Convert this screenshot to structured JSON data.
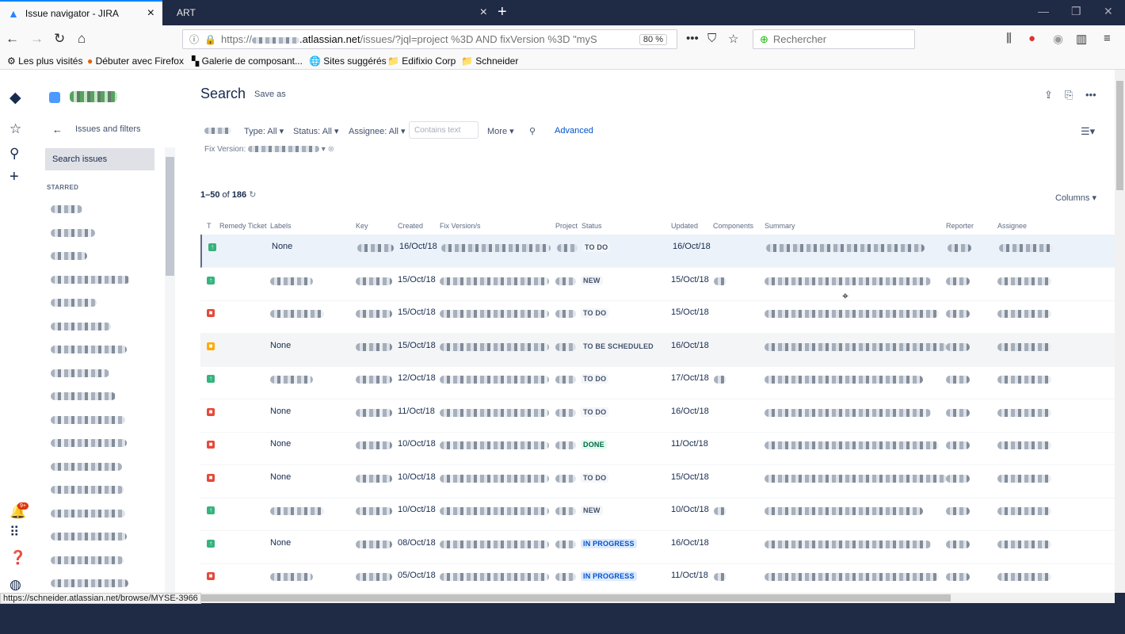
{
  "browser": {
    "tabs": [
      {
        "title": "Issue navigator - JIRA",
        "active": true
      },
      {
        "title": "ART",
        "active": false
      }
    ],
    "url_display": "https://",
    "url_domain": ".atlassian.net",
    "url_rest": "/issues/?jql=project %3D  AND fixVersion %3D \"myS",
    "zoom": "80 %",
    "search_placeholder": "Rechercher",
    "bookmarks": [
      "Les plus visités",
      "Débuter avec Firefox",
      "Galerie de composant...",
      "Sites suggérés",
      "Edifixio Corp",
      "Schneider"
    ],
    "status_url": "https://schneider.atlassian.net/browse/MYSE-3966",
    "accent": "#0a84ff"
  },
  "sidebar": {
    "back_label": "Issues and filters",
    "search_label": "Search issues",
    "starred_label": "STARRED",
    "notification_count": "9+",
    "starred_count": 17
  },
  "main": {
    "title": "Search",
    "save_as": "Save as",
    "filters": {
      "type": "Type: All",
      "status": "Status: All",
      "assignee": "Assignee: All",
      "contains_placeholder": "Contains text",
      "more": "More",
      "advanced": "Advanced",
      "fix_version": "Fix Version:"
    },
    "count_range": "1–50",
    "count_of": "of",
    "count_total": "186",
    "columns_btn": "Columns",
    "headers": [
      "T",
      "Remedy Ticket",
      "Labels",
      "Key",
      "Created",
      "Fix Version/s",
      "Project",
      "Status",
      "Updated",
      "Components",
      "Summary",
      "Reporter",
      "Assignee"
    ],
    "rows": [
      {
        "type": "story",
        "labels": "None",
        "created": "16/Oct/18",
        "status": "TO DO",
        "status_color": "grey",
        "updated": "16/Oct/18"
      },
      {
        "type": "story",
        "labels": "",
        "created": "15/Oct/18",
        "status": "NEW",
        "status_color": "grey",
        "updated": "15/Oct/18"
      },
      {
        "type": "bug",
        "labels": "",
        "created": "15/Oct/18",
        "status": "TO DO",
        "status_color": "grey",
        "updated": "15/Oct/18"
      },
      {
        "type": "task",
        "labels": "None",
        "created": "15/Oct/18",
        "status": "TO BE SCHEDULED",
        "status_color": "grey",
        "updated": "16/Oct/18"
      },
      {
        "type": "story",
        "labels": "",
        "created": "12/Oct/18",
        "status": "TO DO",
        "status_color": "grey",
        "updated": "17/Oct/18"
      },
      {
        "type": "bug",
        "labels": "None",
        "created": "11/Oct/18",
        "status": "TO DO",
        "status_color": "grey",
        "updated": "16/Oct/18"
      },
      {
        "type": "bug",
        "labels": "None",
        "created": "10/Oct/18",
        "status": "DONE",
        "status_color": "green",
        "updated": "11/Oct/18"
      },
      {
        "type": "bug",
        "labels": "None",
        "created": "10/Oct/18",
        "status": "TO DO",
        "status_color": "grey",
        "updated": "15/Oct/18"
      },
      {
        "type": "story",
        "labels": "",
        "created": "10/Oct/18",
        "status": "NEW",
        "status_color": "grey",
        "updated": "10/Oct/18"
      },
      {
        "type": "story",
        "labels": "None",
        "created": "08/Oct/18",
        "status": "IN PROGRESS",
        "status_color": "blue",
        "updated": "16/Oct/18"
      },
      {
        "type": "bug",
        "labels": "",
        "created": "05/Oct/18",
        "status": "IN PROGRESS",
        "status_color": "blue",
        "updated": "11/Oct/18"
      }
    ]
  }
}
